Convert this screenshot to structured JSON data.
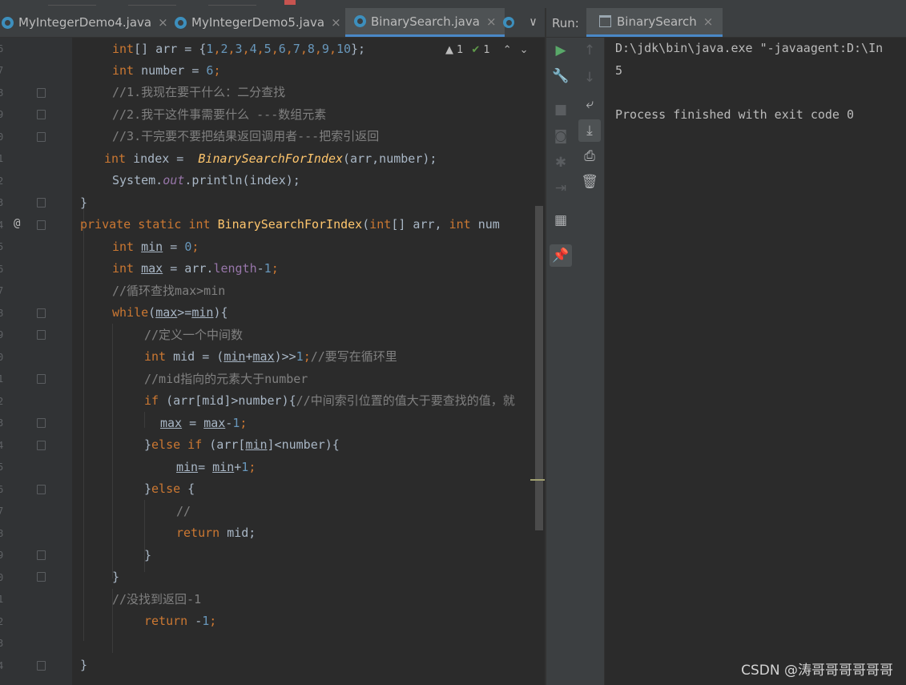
{
  "editor_tabs": [
    {
      "label": "MyIntegerDemo4.java",
      "active": false
    },
    {
      "label": "MyIntegerDemo5.java",
      "active": false
    },
    {
      "label": "BinarySearch.java",
      "active": true
    }
  ],
  "tab_close": "×",
  "tab_overflow": "∨",
  "inspections": {
    "warnings": "1",
    "ok": "1"
  },
  "line_numbers": [
    "6",
    "7",
    "8",
    "9",
    "0",
    "1",
    "2",
    "3",
    "4",
    "5",
    "6",
    "7",
    "8",
    "9",
    "0",
    "1",
    "2",
    "3",
    "4",
    "5",
    "6",
    "7",
    "8",
    "9",
    "0",
    "1",
    "2",
    "3",
    "4"
  ],
  "override_marker": "@",
  "code": {
    "l1": {
      "a": "int",
      "b": "[] arr = {",
      "nums": [
        "1",
        "2",
        "3",
        "4",
        "5",
        "6",
        "7",
        "8",
        "9",
        "10"
      ],
      "c": "};"
    },
    "l2": {
      "a": "int",
      "b": " number = ",
      "n": "6",
      "c": ";"
    },
    "l3": "//1.我现在要干什么：二分查找",
    "l4": "//2.我干这件事需要什么 ---数组元素",
    "l5": "//3.干完要不要把结果返回调用者---把索引返回",
    "l6": {
      "a": "int",
      "b": " index =  ",
      "f": "BinarySearchForIndex",
      "c": "(arr,number);"
    },
    "l7": {
      "a": "System.",
      "b": "out",
      "c": ".println(index);"
    },
    "l8": "}",
    "l9": {
      "a": "private static int ",
      "f": "BinarySearchForIndex",
      "b": "(",
      "c": "int",
      "d": "[] arr, ",
      "e": "int",
      "g": " num"
    },
    "l10": {
      "a": "int",
      "v": "min",
      "b": " = ",
      "n": "0",
      "c": ";"
    },
    "l11": {
      "a": "int",
      "v": "max",
      "b": " = arr.",
      "f": "length",
      "c": "-",
      "n": "1",
      "d": ";"
    },
    "l12": "//循环查找max>min",
    "l13": {
      "a": "while",
      "b": "(",
      "v1": "max",
      "c": ">=",
      "v2": "min",
      "d": "){"
    },
    "l14": "//定义一个中间数",
    "l15": {
      "a": "int",
      "b": " mid = (",
      "v1": "min",
      "c": "+",
      "v2": "max",
      "d": ")>>",
      "n": "1",
      "e": ";",
      "cm": "//要写在循环里"
    },
    "l16": "//mid指向的元素大于number",
    "l17": {
      "a": "if",
      "b": " (arr[mid]>number){",
      "cm": "//中间索引位置的值大于要查找的值，就"
    },
    "l18": {
      "v1": "max",
      "b": " = ",
      "v2": "max",
      "c": "-",
      "n": "1",
      "d": ";"
    },
    "l19": {
      "a": "}",
      "k1": "else if",
      "b": " (arr[",
      "v": "min",
      "c": "]<number){"
    },
    "l20": {
      "v1": "min",
      "b": "= ",
      "v2": "min",
      "c": "+",
      "n": "1",
      "d": ";"
    },
    "l21": {
      "a": "}",
      "k": "else",
      "b": " {"
    },
    "l22": "//",
    "l23": {
      "a": "return",
      "b": " mid;"
    },
    "l24": "}",
    "l25": "}",
    "l26": "//没找到返回-1",
    "l27": {
      "a": "return",
      "b": " -",
      "n": "1",
      "c": ";"
    },
    "l28": "}"
  },
  "run_panel": {
    "label": "Run:",
    "tab": "BinarySearch",
    "close": "×",
    "output": [
      "D:\\jdk\\bin\\java.exe \"-javaagent:D:\\In",
      "5",
      "",
      "Process finished with exit code 0"
    ]
  },
  "icons": {
    "tool1": [
      "play-icon",
      "wrench-icon",
      "stop-icon",
      "camera-icon",
      "bug-icon",
      "exit-icon",
      "layout-icon",
      "pin-icon"
    ],
    "tool2": [
      "arrow-up-icon",
      "arrow-down-icon",
      "soft-wrap-icon",
      "scroll-end-icon",
      "print-icon",
      "trash-icon"
    ]
  },
  "watermark": "CSDN @涛哥哥哥哥哥哥"
}
